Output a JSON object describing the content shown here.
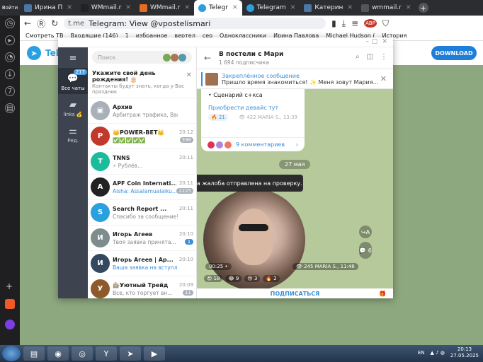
{
  "browser": {
    "tabs": [
      {
        "label": "Ирина П",
        "color": "#4a76a8"
      },
      {
        "label": "WMmail.r",
        "color": "#222222"
      },
      {
        "label": "WMmail.r",
        "color": "#e07020"
      },
      {
        "label": "Telegr",
        "color": "#2aa0e0",
        "active": true
      },
      {
        "label": "Telegram",
        "color": "#2aa0e0"
      },
      {
        "label": "Катерин",
        "color": "#4a76a8"
      },
      {
        "label": "wmmail.r",
        "color": "#555555"
      }
    ],
    "url": "t.me",
    "page_title": "Telegram: View @vpostelismari",
    "bookmarks": [
      "Смотреть ТВ",
      "Входящие (146)",
      "1",
      "избранное",
      "вертел",
      "сео",
      "Одноклассники",
      "Ирина Павлова",
      "Michael Hudson (",
      "История"
    ],
    "rail_label": "Войти"
  },
  "page": {
    "brand": "Telegram",
    "download_label": "DOWNLOAD"
  },
  "rail": {
    "all_chats_label": "Все чаты",
    "all_chats_count": "217",
    "links_label": "links 💰",
    "edit_label": "Ред."
  },
  "chatlist": {
    "search_placeholder": "Поиск",
    "birthday_title": "Укажите свой день рождения! 🎂",
    "birthday_sub": "Контакты будут знать, когда у Вас праздник",
    "chats": [
      {
        "name": "Архив",
        "preview": "Арбитраж трафика, Вакансии...",
        "time": "",
        "badge": "",
        "color": "#a9b0b8",
        "initial": "▣"
      },
      {
        "name": "👑POWER-BET👑",
        "preview": "✅✅✅✅✅",
        "time": "20:12",
        "badge": "398",
        "color": "#c0392b",
        "initial": "P"
      },
      {
        "name": "TNNS",
        "preview": "⚡ Рублёв…",
        "time": "20:11",
        "badge": "",
        "color": "#1abc9c",
        "initial": "T"
      },
      {
        "name": "APF Coin Internati...",
        "preview": "Aisha: Assalamualaiku...",
        "time": "20:11",
        "badge": "2225",
        "color": "#222222",
        "initial": "A",
        "blue": true
      },
      {
        "name": "Search Report ...",
        "preview": "Спасибо за сообщение! Ва...",
        "time": "20:11",
        "badge": "",
        "color": "#2aa0e0",
        "initial": "S"
      },
      {
        "name": "Игорь Агеев",
        "preview": "Твоя заявка принята...",
        "time": "20:10",
        "badge": "1",
        "color": "#7f8c8d",
        "initial": "И",
        "badgeblue": true
      },
      {
        "name": "Игорь Агеев | Ар...",
        "preview": "Ваша заявка на вступление ...",
        "time": "20:10",
        "badge": "",
        "color": "#34495e",
        "initial": "И",
        "blue": true
      },
      {
        "name": "🎰Уютный Трейд",
        "preview": "Все, кто торгует вн...",
        "time": "20:09",
        "badge": "11",
        "color": "#8e5a2b",
        "initial": "У"
      }
    ]
  },
  "chat": {
    "title": "В постели с Мари",
    "subscribers": "1 694 подписчика",
    "pinned_title": "Закреплённое сообщение",
    "pinned_text": "Пришло время знакомиться! ✨ Меня зовут Мария...",
    "post_line": "• Сценарий с+кса",
    "post_link": "Приобрести девайс тут",
    "post_reaction": "🔥 21",
    "post_views": "👁 422  MARIA S., 13:39",
    "comments_label": "9 комментариев",
    "date_pill": "27 мая",
    "toast": "Спасибо! Ваша жалоба отправлена на проверку.",
    "video_duration": "00:25 •",
    "video_meta": "👁 245  MARIA S., 11:48",
    "side_buttons": [
      "↪A",
      "💬 6"
    ],
    "reactions": [
      "😍 18",
      "😂 9",
      "😢 3",
      "🔥 2"
    ],
    "subscribe_label": "ПОДПИСАТЬСЯ"
  },
  "taskbar": {
    "lang": "EN",
    "time": "20:13",
    "date": "27.05.2025"
  }
}
